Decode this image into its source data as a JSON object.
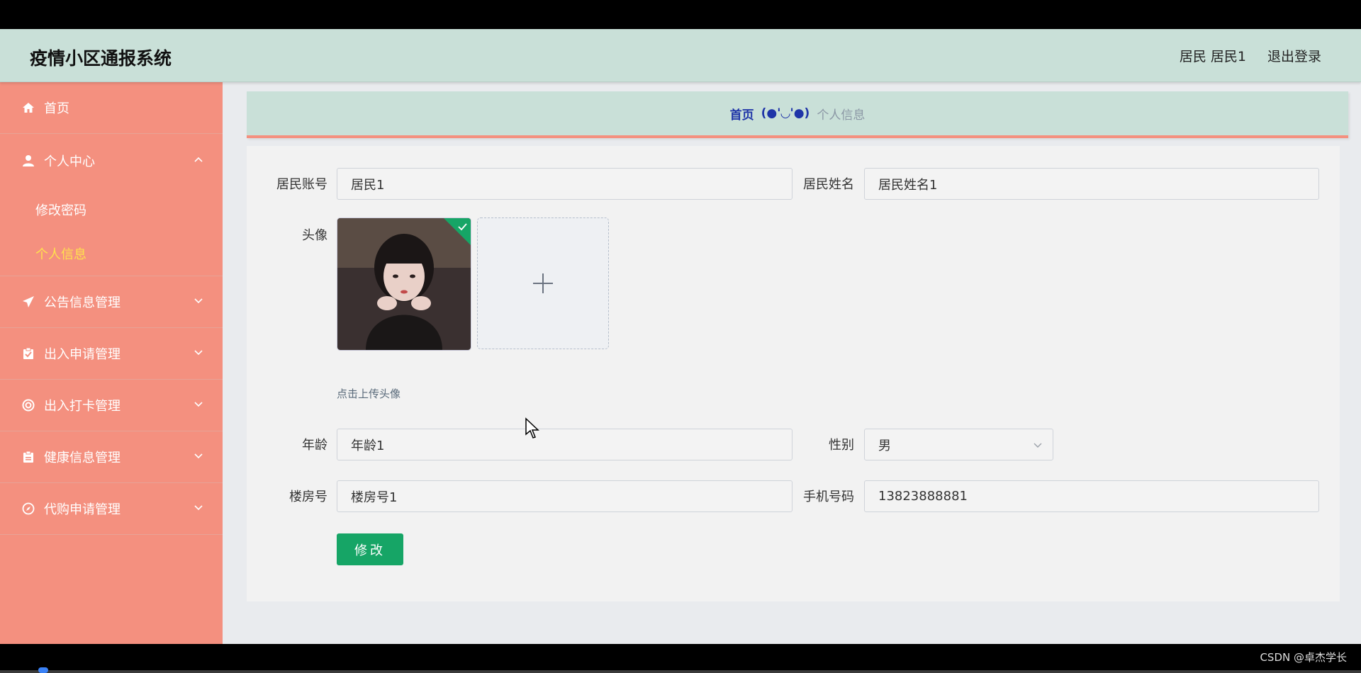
{
  "header": {
    "app_title": "疫情小区通报系统",
    "user_role": "居民",
    "user_name": "居民1",
    "logout_label": "退出登录"
  },
  "sidebar": {
    "items": [
      {
        "label": "首页",
        "icon": "home-icon"
      },
      {
        "label": "个人中心",
        "icon": "user-icon",
        "expanded": true,
        "children": [
          {
            "label": "修改密码",
            "active": false
          },
          {
            "label": "个人信息",
            "active": true
          }
        ]
      },
      {
        "label": "公告信息管理",
        "icon": "paper-plane-icon"
      },
      {
        "label": "出入申请管理",
        "icon": "clipboard-check-icon"
      },
      {
        "label": "出入打卡管理",
        "icon": "lifebuoy-icon"
      },
      {
        "label": "健康信息管理",
        "icon": "clipboard-icon"
      },
      {
        "label": "代购申请管理",
        "icon": "compass-icon"
      }
    ]
  },
  "breadcrumb": {
    "home": "首页",
    "separator": "(●'◡'●)",
    "current": "个人信息"
  },
  "form": {
    "account_label": "居民账号",
    "account_value": "居民1",
    "name_label": "居民姓名",
    "name_value": "居民姓名1",
    "avatar_label": "头像",
    "upload_hint": "点击上传头像",
    "age_label": "年龄",
    "age_value": "年龄1",
    "gender_label": "性别",
    "gender_value": "男",
    "building_label": "楼房号",
    "building_value": "楼房号1",
    "phone_label": "手机号码",
    "phone_value": "13823888881",
    "submit_label": "修改"
  },
  "colors": {
    "header_bg": "#c9e0d8",
    "sidebar_bg": "#f4907f",
    "active_menu_text": "#ffe14d",
    "submit_bg": "#16a566",
    "breadcrumb_home": "#1f35a8"
  },
  "watermark": "CSDN @卓杰学长"
}
